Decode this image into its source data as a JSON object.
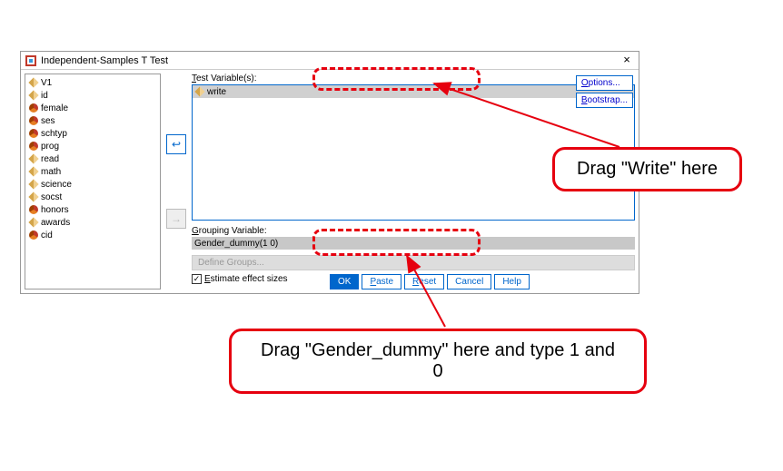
{
  "dialog": {
    "title": "Independent-Samples T Test",
    "close_glyph": "×"
  },
  "variables": [
    {
      "name": "V1",
      "type": "scale"
    },
    {
      "name": "id",
      "type": "scale"
    },
    {
      "name": "female",
      "type": "nominal"
    },
    {
      "name": "ses",
      "type": "nominal"
    },
    {
      "name": "schtyp",
      "type": "nominal"
    },
    {
      "name": "prog",
      "type": "nominal"
    },
    {
      "name": "read",
      "type": "scale"
    },
    {
      "name": "math",
      "type": "scale"
    },
    {
      "name": "science",
      "type": "scale"
    },
    {
      "name": "socst",
      "type": "scale"
    },
    {
      "name": "honors",
      "type": "nominal"
    },
    {
      "name": "awards",
      "type": "scale"
    },
    {
      "name": "cid",
      "type": "nominal"
    }
  ],
  "labels": {
    "test_variables": "Test Variable(s):",
    "grouping_variable": "Grouping Variable:",
    "define_groups": "Define Groups...",
    "estimate_effect": "Estimate effect sizes"
  },
  "test_variable_selected": "write",
  "grouping_variable_value": "Gender_dummy(1 0)",
  "side_buttons": {
    "options": "Options...",
    "bootstrap": "Bootstrap..."
  },
  "bottom_buttons": {
    "ok": "OK",
    "paste": "Paste",
    "reset": "Reset",
    "cancel": "Cancel",
    "help": "Help"
  },
  "estimate_checked": true,
  "arrows": {
    "add_test": "↩",
    "add_group": "→"
  },
  "annotations": {
    "callout1": "Drag \"Write\" here",
    "callout2": "Drag \"Gender_dummy\" here and type 1 and 0"
  }
}
